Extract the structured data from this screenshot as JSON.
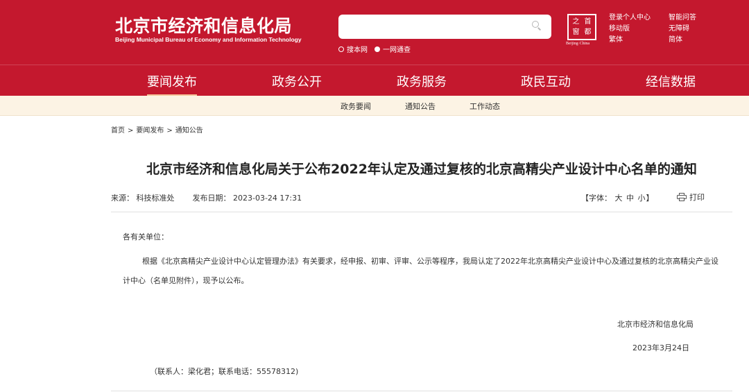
{
  "header": {
    "logo_cn": "北京市经济和信息化局",
    "logo_en": "Beijing Municipal Bureau of Economy and Information Technology",
    "search": {
      "placeholder": "",
      "options": [
        "搜本网",
        "一网通查"
      ],
      "selected_index": 1
    },
    "seal": {
      "chars": [
        "之",
        "首",
        "窗",
        "都"
      ],
      "caption": "Beijing·China"
    },
    "tools": [
      "登录个人中心",
      "智能问答",
      "移动版",
      "无障碍",
      "繁体",
      "简体"
    ]
  },
  "main_nav": {
    "items": [
      "要闻发布",
      "政务公开",
      "政务服务",
      "政民互动",
      "经信数据"
    ],
    "active_index": 0
  },
  "sub_nav": {
    "items": [
      "政务要闻",
      "通知公告",
      "工作动态"
    ]
  },
  "breadcrumb": {
    "items": [
      "首页",
      "要闻发布",
      "通知公告"
    ],
    "separator": ">"
  },
  "article": {
    "title": "北京市经济和信息化局关于公布2022年认定及通过复核的北京高精尖产业设计中心名单的通知",
    "source_label": "来源：",
    "source": "科技标准处",
    "date_label": "发布日期：",
    "date": "2023-03-24 17:31",
    "font_label_open": "【字体：",
    "font_sizes": [
      "大",
      "中",
      "小"
    ],
    "font_label_close": "】",
    "print_label": "打印",
    "salutation": "各有关单位：",
    "body": "根据《北京高精尖产业设计中心认定管理办法》有关要求，经申报、初审、评审、公示等程序，我局认定了2022年北京高精尖产业设计中心及通过复核的北京高精尖产业设计中心（名单见附件），现予以公布。",
    "signature_org": "北京市经济和信息化局",
    "signature_date": "2023年3月24日",
    "contact": "（联系人：梁化君；联系电话：55578312)"
  },
  "colors": {
    "brand_red": "#c4182e",
    "subnav_bg": "#fcf3e4",
    "active_underline": "#f5c39a"
  }
}
